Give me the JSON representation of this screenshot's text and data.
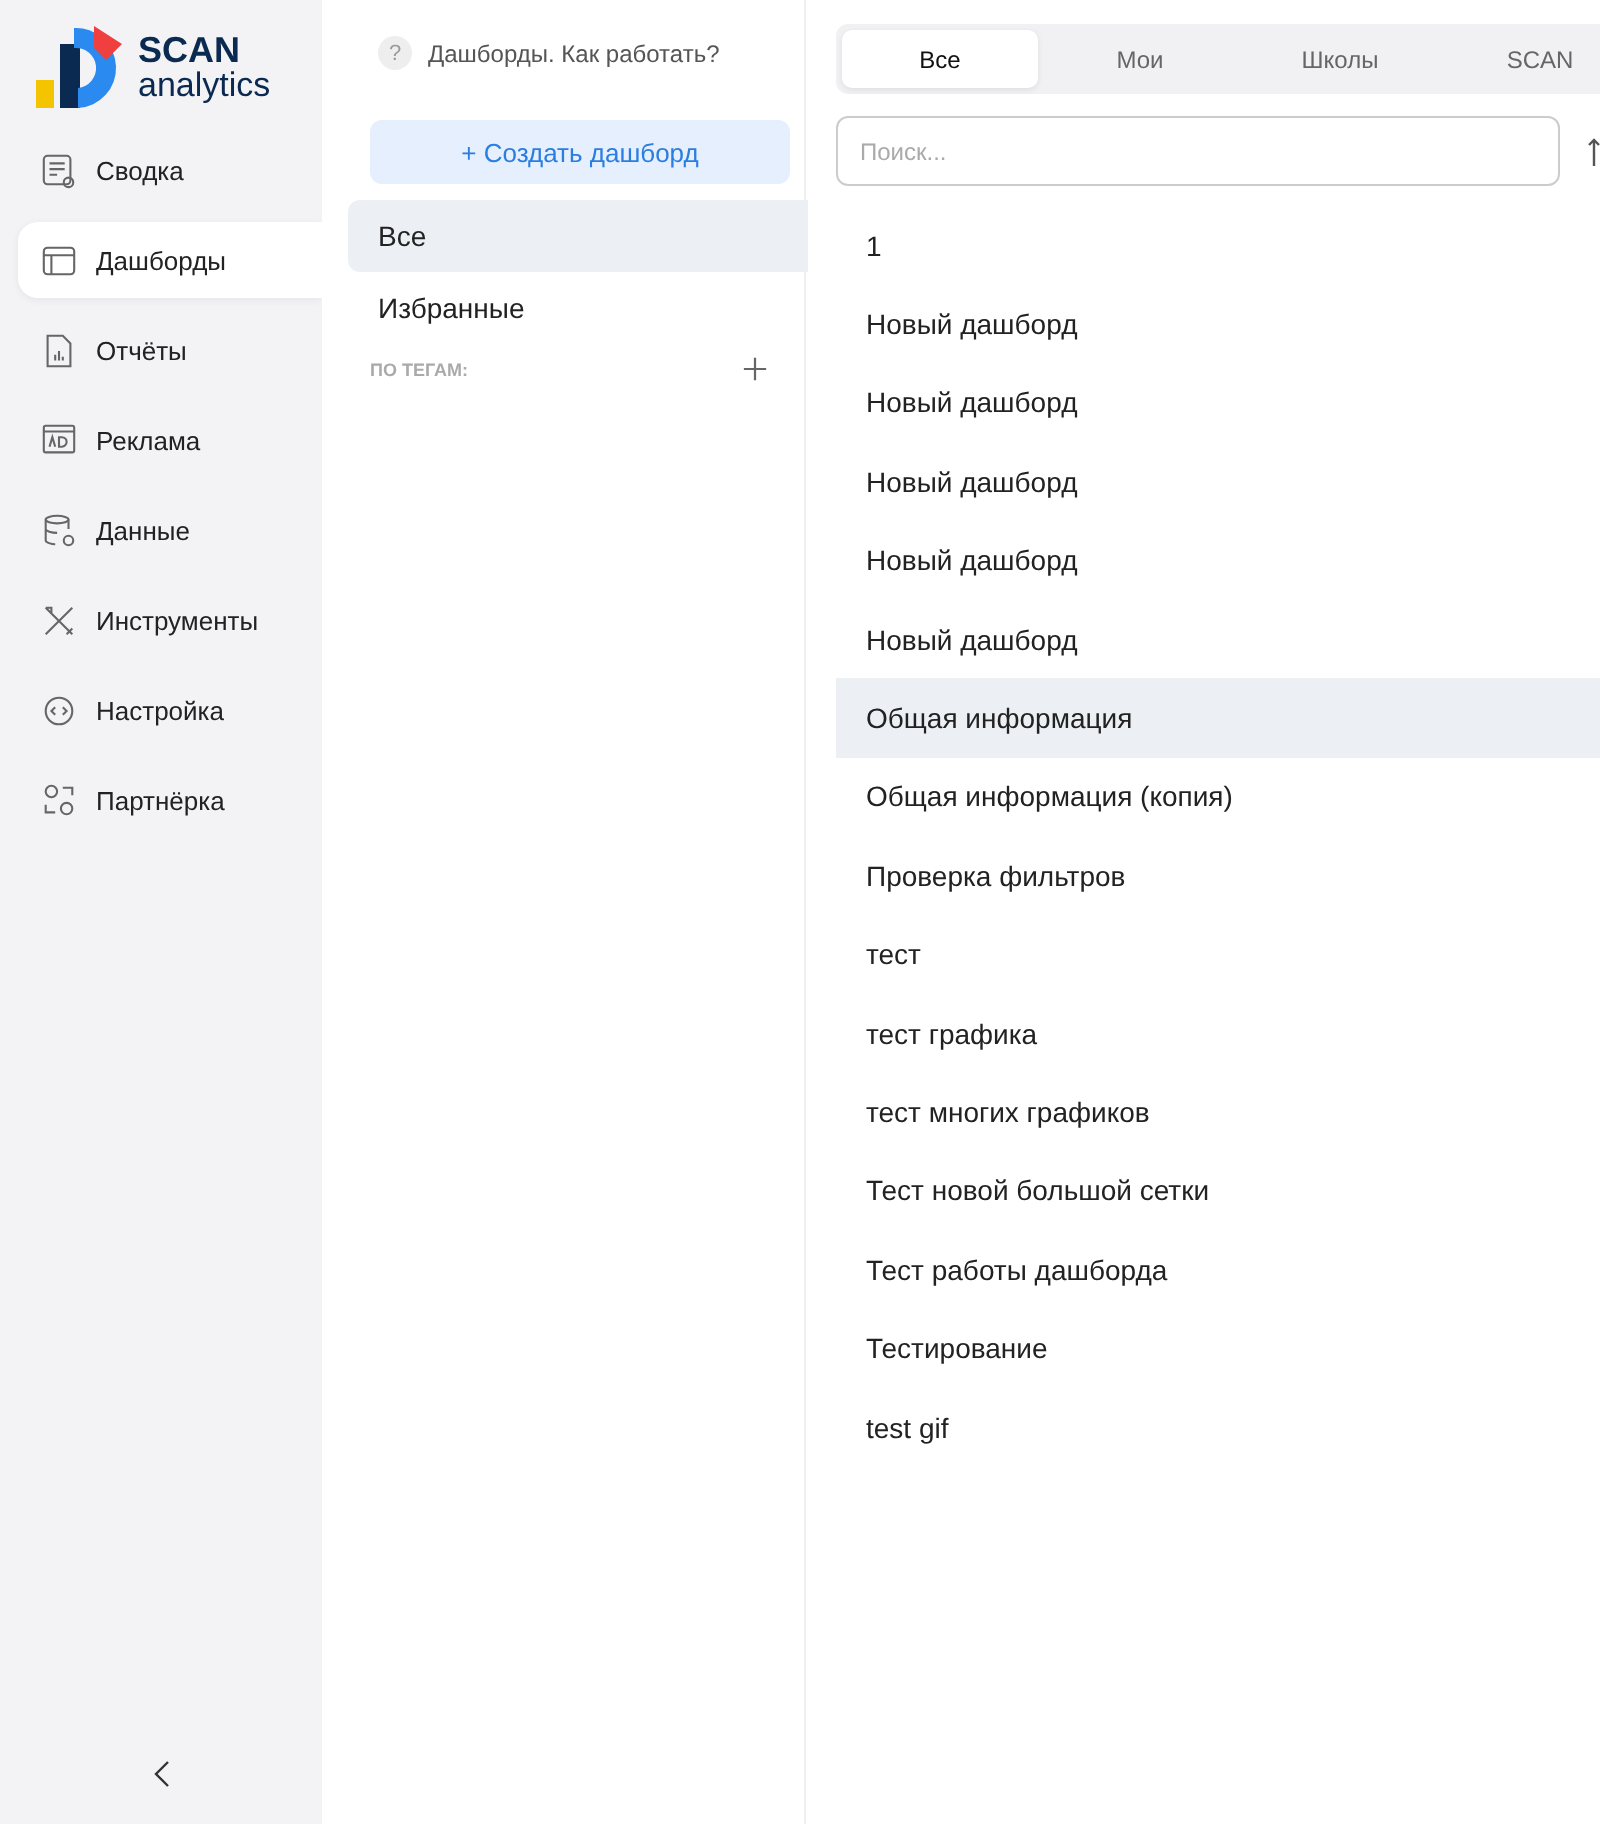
{
  "logo": {
    "title": "SCAN",
    "subtitle": "analytics"
  },
  "sidebar": {
    "items": [
      {
        "label": "Сводка",
        "selected": false
      },
      {
        "label": "Дашборды",
        "selected": true
      },
      {
        "label": "Отчёты",
        "selected": false
      },
      {
        "label": "Реклама",
        "selected": false
      },
      {
        "label": "Данные",
        "selected": false
      },
      {
        "label": "Инструменты",
        "selected": false
      },
      {
        "label": "Настройка",
        "selected": false
      },
      {
        "label": "Партнёрка",
        "selected": false
      }
    ]
  },
  "help": {
    "icon": "?",
    "label": "Дашборды. Как работать?"
  },
  "create_button": "+ Создать дашборд",
  "filters": [
    {
      "label": "Все",
      "selected": true
    },
    {
      "label": "Избранные",
      "selected": false
    }
  ],
  "tags_heading": "ПО ТЕГАМ:",
  "tabs": [
    {
      "label": "Все",
      "selected": true
    },
    {
      "label": "Мои",
      "selected": false
    },
    {
      "label": "Школы",
      "selected": false
    },
    {
      "label": "SCAN",
      "selected": false
    }
  ],
  "search": {
    "placeholder": "Поиск..."
  },
  "dashboards": [
    {
      "name": "1",
      "selected": false
    },
    {
      "name": "Новый дашборд",
      "selected": false
    },
    {
      "name": "Новый дашборд",
      "selected": false
    },
    {
      "name": "Новый дашборд",
      "selected": false
    },
    {
      "name": "Новый дашборд",
      "selected": false
    },
    {
      "name": "Новый дашборд",
      "selected": false
    },
    {
      "name": "Общая информация",
      "selected": true
    },
    {
      "name": "Общая информация (копия)",
      "selected": false
    },
    {
      "name": "Проверка фильтров",
      "selected": false
    },
    {
      "name": "тест",
      "selected": false
    },
    {
      "name": "тест графика",
      "selected": false
    },
    {
      "name": "тест многих графиков",
      "selected": false
    },
    {
      "name": "Тест новой большой сетки",
      "selected": false
    },
    {
      "name": "Тест работы дашборда",
      "selected": false
    },
    {
      "name": "Тестирование",
      "selected": false
    },
    {
      "name": "test gif",
      "selected": false
    }
  ]
}
